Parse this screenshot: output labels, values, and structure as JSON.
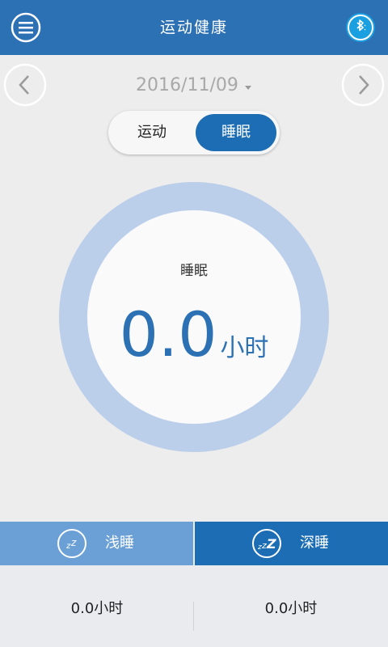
{
  "header": {
    "title": "运动健康",
    "menu_icon": "menu-icon",
    "bluetooth_icon": "bluetooth-icon"
  },
  "date_nav": {
    "date": "2016/11/09",
    "prev_icon": "chevron-left-icon",
    "next_icon": "chevron-right-icon"
  },
  "segment": {
    "items": [
      {
        "label": "运动",
        "selected": false
      },
      {
        "label": "睡眠",
        "selected": true
      }
    ]
  },
  "ring": {
    "label": "睡眠",
    "value": "0.0",
    "unit": "小时",
    "progress": 0
  },
  "tabs": [
    {
      "label": "浅睡",
      "icon": "sleep-zz-icon",
      "active": false
    },
    {
      "label": "深睡",
      "icon": "sleep-zzz-icon",
      "active": true
    }
  ],
  "stats": {
    "light_sleep": "0.0小时",
    "deep_sleep": "0.0小时"
  },
  "colors": {
    "primary": "#2d71b5",
    "ring_track": "#bccfea",
    "tab_light": "#6ba0d6",
    "tab_dark": "#1d6db5"
  }
}
